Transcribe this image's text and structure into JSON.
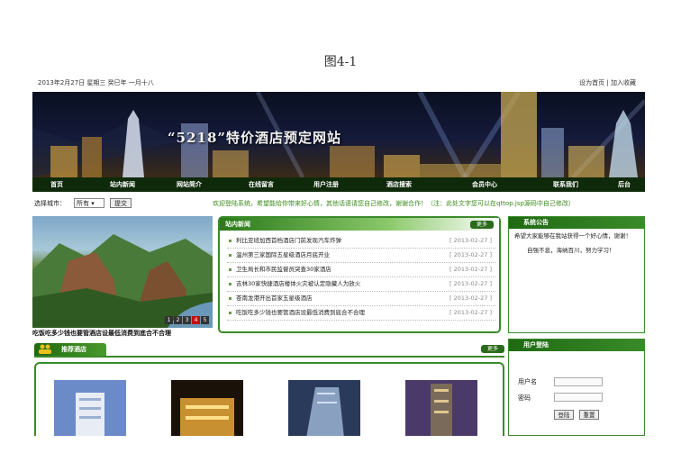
{
  "figure_caption": "图4-1",
  "topbar": {
    "date": "2013年2月27日 星期三 癸巳年 一月十八",
    "set_home": "设为首页",
    "separator": "|",
    "add_favorite": "加入收藏"
  },
  "banner": {
    "title": "“5218”特价酒店预定网站"
  },
  "nav": [
    {
      "label": "首页"
    },
    {
      "label": "站内新闻"
    },
    {
      "label": "网站简介"
    },
    {
      "label": "在线留言"
    },
    {
      "label": "用户注册"
    },
    {
      "label": "酒店搜索"
    },
    {
      "label": "会员中心"
    },
    {
      "label": "联系我们"
    },
    {
      "label": "后台"
    }
  ],
  "citybar": {
    "label": "选择城市：",
    "selected_city": "所有",
    "submit": "提交",
    "marquee": "欢迎登陆系统，希望能给你带来好心情，其他话语请您自己修改，谢谢合作！（注：此处文字您可以在qttop.jsp源码中自己修改）"
  },
  "photo": {
    "caption": "吃饭吃多少钱也要管酒店设最低消费到底合不合理",
    "pages": [
      "1",
      "2",
      "3",
      "4",
      "5"
    ],
    "active_page": "4"
  },
  "news": {
    "title": "站内新闻",
    "more": "更多",
    "items": [
      {
        "title": "利比亚班加西首档酒店门前发现汽车炸弹",
        "date": "[ 2013-02-27 ]"
      },
      {
        "title": "温州第三家国际五星级酒店月底开业",
        "date": "[ 2013-02-27 ]"
      },
      {
        "title": "卫生局长和市民监督员突查30家酒店",
        "date": "[ 2013-02-27 ]"
      },
      {
        "title": "吉林30家快捷酒店楼体火灾被认定隐藏人为放火",
        "date": "[ 2013-02-27 ]"
      },
      {
        "title": "苍南龙港开出首家五星级酒店",
        "date": "[ 2013-02-27 ]"
      },
      {
        "title": "吃饭吃多少钱也要管酒店设最低消费到底合不合理",
        "date": "[ 2013-02-27 ]"
      }
    ]
  },
  "notice": {
    "title": "系统公告",
    "text": "希望大家能够在我站获得一个好心情，谢谢！",
    "slogan": "自强不息，海纳百川，努力学习！"
  },
  "login": {
    "title": "用户登陆",
    "username_label": "用户名",
    "password_label": "密码",
    "login_button": "登陆",
    "reset_button": "重置"
  },
  "recommend": {
    "title": "推荐酒店",
    "more": "更多"
  }
}
